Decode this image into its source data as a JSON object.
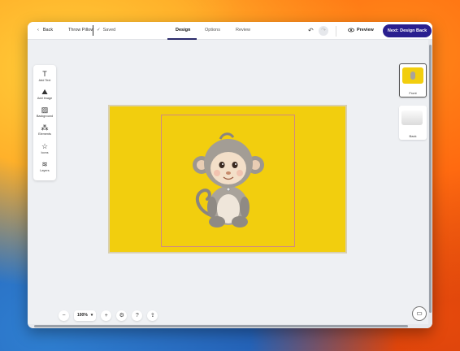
{
  "header": {
    "back_label": "Back",
    "product_title": "Throw Pillow",
    "saved_label": "Saved",
    "tabs": [
      {
        "label": "Design",
        "active": true
      },
      {
        "label": "Options",
        "active": false
      },
      {
        "label": "Review",
        "active": false
      }
    ],
    "preview_label": "Preview",
    "next_label": "Next: Design Back"
  },
  "toolbar": {
    "items": [
      {
        "label": "Add Text",
        "icon": "text-icon"
      },
      {
        "label": "Add Image",
        "icon": "image-upload-icon"
      },
      {
        "label": "Background",
        "icon": "background-icon"
      },
      {
        "label": "Elements",
        "icon": "elements-icon"
      },
      {
        "label": "Icons",
        "icon": "star-icon"
      },
      {
        "label": "Layers",
        "icon": "layers-icon"
      }
    ]
  },
  "canvas": {
    "background_color": "#f2ce0e",
    "image_subject": "watercolor baby monkey"
  },
  "thumbnails": [
    {
      "label": "Front",
      "selected": true
    },
    {
      "label": "Back",
      "selected": false
    }
  ],
  "zoom": {
    "value": "100%"
  },
  "colors": {
    "accent": "#2a1f8f",
    "canvas_yellow": "#f2ce0e"
  }
}
